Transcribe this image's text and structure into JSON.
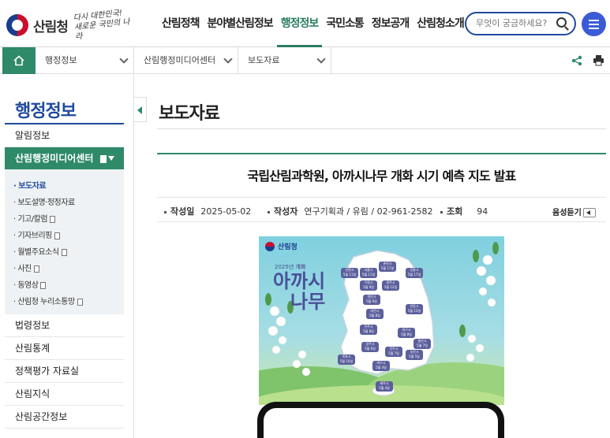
{
  "header": {
    "logo_text": "산림청",
    "slogan": "다시 대한민국! 새로운 국민의 나라",
    "nav": [
      "산림정책",
      "분야별산림정보",
      "행정정보",
      "국민소통",
      "정보공개",
      "산림청소개"
    ],
    "active_nav": "행정정보",
    "search_placeholder": "무엇이 궁금하세요?"
  },
  "breadcrumb": {
    "items": [
      "행정정보",
      "산림행정미디어센터",
      "보도자료"
    ]
  },
  "sidebar": {
    "title": "행정정보",
    "items_before": [
      "알림정보"
    ],
    "active_item": "산림행정미디어센터",
    "sub_items": [
      {
        "label": "보도자료",
        "active": true,
        "external": false
      },
      {
        "label": "보도설명·정정자료",
        "active": false,
        "external": false
      },
      {
        "label": "기고/칼럼",
        "active": false,
        "external": true
      },
      {
        "label": "기자브리핑",
        "active": false,
        "external": true
      },
      {
        "label": "월별주요소식",
        "active": false,
        "external": true
      },
      {
        "label": "사진",
        "active": false,
        "external": true
      },
      {
        "label": "동영상",
        "active": false,
        "external": true
      },
      {
        "label": "산림청 누리소통망",
        "active": false,
        "external": true
      }
    ],
    "items_after": [
      "법령정보",
      "산림통계",
      "정책평가 자료실",
      "산림지식",
      "산림공간정보"
    ]
  },
  "main": {
    "page_title": "보도자료",
    "article_title": "국립산림과학원, 아까시나무 개화 시기 예측 지도 발표",
    "meta": {
      "date_label": "작성일",
      "date": "2025-05-02",
      "author_label": "작성자",
      "author": "연구기획과 / 유림 / 02-961-2582",
      "views_label": "조회",
      "views": "94"
    },
    "listen_label": "음성듣기"
  },
  "poster": {
    "brand": "산림청",
    "year_label": "2025년",
    "year_label_accent": "개화",
    "title_line1": "아까시",
    "title_line2": "나무",
    "regions": [
      {
        "name": "인천시",
        "date": "5월 11일"
      },
      {
        "name": "서울시",
        "date": "5월 11일"
      },
      {
        "name": "춘천시",
        "date": "5월 17일"
      },
      {
        "name": "강릉시",
        "date": "5월 17일"
      },
      {
        "name": "수원시",
        "date": "5월 9일"
      },
      {
        "name": "원주시",
        "date": "5월 12일"
      },
      {
        "name": "천안시",
        "date": "5월 9일"
      },
      {
        "name": "안동시",
        "date": "5월 13일"
      },
      {
        "name": "대전시",
        "date": "5월 8일"
      },
      {
        "name": "대구시",
        "date": "5월 8일"
      },
      {
        "name": "전주시",
        "date": "5월 8일"
      },
      {
        "name": "울산시",
        "date": "5월 7일"
      },
      {
        "name": "광주시",
        "date": "5월 6일"
      },
      {
        "name": "진주시",
        "date": "5월 7일"
      },
      {
        "name": "부산시",
        "date": "5월 5일"
      },
      {
        "name": "목포시",
        "date": "5월 10일"
      },
      {
        "name": "여수시",
        "date": "5월 4일"
      },
      {
        "name": "제주시",
        "date": "5월 4일"
      }
    ]
  },
  "colors": {
    "brand_green": "#2f8a6a",
    "brand_blue": "#1f4a9e",
    "menu_button": "#3b5bd6"
  },
  "icons": {
    "home": "home-icon",
    "share": "share-icon",
    "print": "print-icon",
    "search": "search-icon",
    "menu": "hamburger-icon"
  }
}
